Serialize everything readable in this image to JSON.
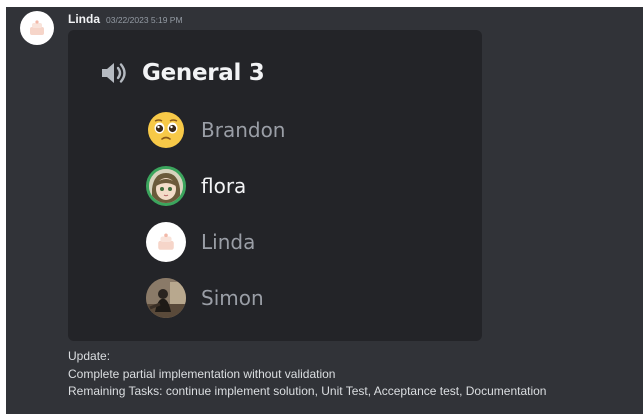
{
  "message": {
    "username": "Linda",
    "timestamp": "03/22/2023 5:19 PM",
    "lines": [
      "Update:",
      "Complete partial implementation without validation",
      "Remaining Tasks: continue implement solution, Unit Test, Acceptance test, Documentation"
    ]
  },
  "voice_embed": {
    "channel_icon": "speaker-icon",
    "channel_name": "General 3",
    "members": [
      {
        "name": "Brandon",
        "avatar": "pleading-face-emoji",
        "speaking": false
      },
      {
        "name": "flora",
        "avatar": "anime-girl-avatar",
        "speaking": true
      },
      {
        "name": "Linda",
        "avatar": "cake-avatar",
        "speaking": false
      },
      {
        "name": "Simon",
        "avatar": "photo-avatar",
        "speaking": false
      }
    ]
  },
  "colors": {
    "background": "#313338",
    "embed_background": "#232428",
    "speaking_ring": "#3ba55d",
    "inactive_name": "#9a9ea6",
    "active_name": "#f2f3f5"
  }
}
